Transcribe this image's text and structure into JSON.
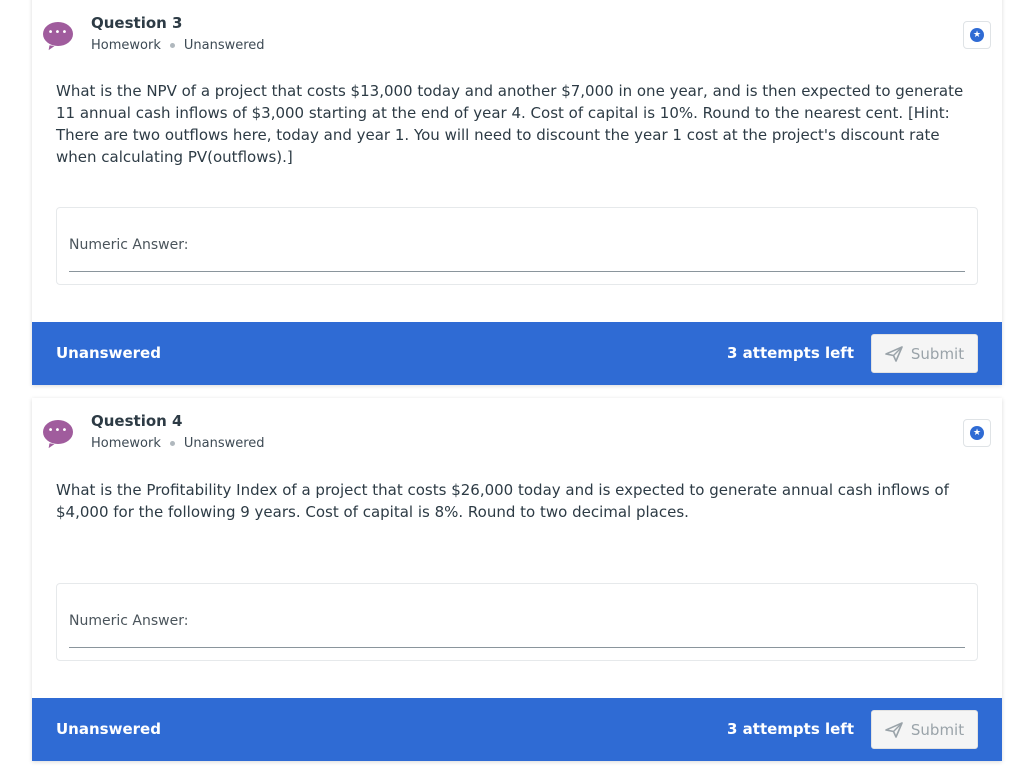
{
  "questions": [
    {
      "title": "Question 3",
      "category": "Homework",
      "status_meta": "Unanswered",
      "text": "What is the NPV of a project that costs $13,000 today and another $7,000 in one year, and is then expected to generate 11 annual cash inflows of $3,000 starting at the end of year 4. Cost of capital is 10%. Round to the nearest cent. [Hint: There are two outflows here, today and year 1. You will need to discount the year 1 cost at the project's discount rate when calculating PV(outflows).]",
      "answer_label": "Numeric Answer:",
      "answer_value": "",
      "footer_status": "Unanswered",
      "attempts": "3 attempts left",
      "submit_label": "Submit"
    },
    {
      "title": "Question 4",
      "category": "Homework",
      "status_meta": "Unanswered",
      "text": "What is the Profitability Index of a project that costs $26,000 today and is expected to generate annual cash inflows of $4,000 for the following 9 years. Cost of capital is 8%. Round to two decimal places.",
      "answer_label": "Numeric Answer:",
      "answer_value": "",
      "footer_status": "Unanswered",
      "attempts": "3 attempts left",
      "submit_label": "Submit"
    }
  ],
  "icons": {
    "avatar": "chat-bubble-icon",
    "star": "star-icon",
    "submit": "paper-plane-icon"
  },
  "colors": {
    "accent": "#2f6bd4",
    "avatar": "#a05c9d",
    "submit_disabled_bg": "#f5f5f5",
    "submit_disabled_text": "#9aa3a9"
  }
}
